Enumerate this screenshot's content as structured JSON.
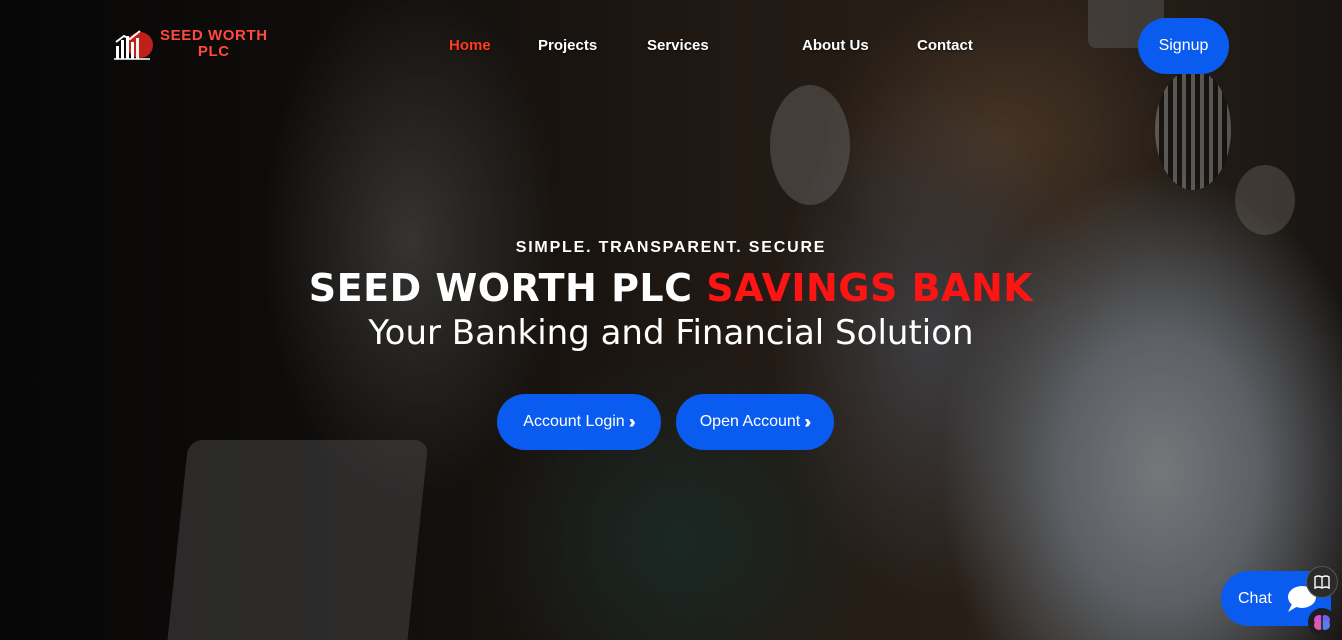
{
  "logo": {
    "line1": "SEED WORTH",
    "line2": "PLC",
    "brand_color": "#ff4a3d"
  },
  "nav": {
    "items": [
      {
        "label": "Home",
        "active": true
      },
      {
        "label": "Projects",
        "active": false
      },
      {
        "label": "Services",
        "active": false
      },
      {
        "label": "About Us",
        "active": false
      },
      {
        "label": "Contact",
        "active": false
      }
    ],
    "active_color": "#ff3b1f"
  },
  "signup": {
    "label": "Signup"
  },
  "hero": {
    "tagline": "SIMPLE. TRANSPARENT. SECURE",
    "headline_main": "SEED WORTH PLC",
    "headline_accent": "SAVINGS BANK",
    "accent_color": "#ff1414",
    "subline": "Your Banking and Financial Solution",
    "buttons": [
      {
        "label": "Account Login",
        "icon": "double-chevron-right-icon"
      },
      {
        "label": "Open Account",
        "icon": "double-chevron-right-icon"
      }
    ],
    "button_color": "#0a5cf0"
  },
  "chat": {
    "label": "Chat",
    "icon": "chat-bubble-icon"
  },
  "side_tools": [
    {
      "icon": "book-icon"
    },
    {
      "icon": "brain-icon"
    }
  ]
}
